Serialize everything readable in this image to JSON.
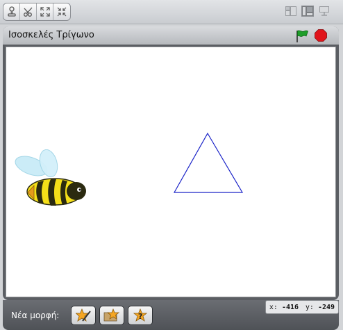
{
  "toolbar": {
    "tools": [
      {
        "icon": "stamp-icon"
      },
      {
        "icon": "scissors-icon"
      },
      {
        "icon": "grow-icon"
      },
      {
        "icon": "shrink-icon"
      }
    ],
    "view_modes": [
      {
        "icon": "small-stage-icon"
      },
      {
        "icon": "normal-stage-icon",
        "active": true
      },
      {
        "icon": "presentation-mode-icon"
      }
    ]
  },
  "stage": {
    "title": "Ισοσκελές Τρίγωνο",
    "green_flag_icon": "green-flag-icon",
    "stop_icon": "stop-sign-icon",
    "background": "#ffffff",
    "triangle_color": "#1a23c8",
    "sprite_name_icon": "bee-icon"
  },
  "bottom": {
    "new_sprite_label": "Νέα μορφή:",
    "buttons": [
      {
        "icon": "paint-new-sprite-icon"
      },
      {
        "icon": "choose-sprite-from-file-icon"
      },
      {
        "icon": "surprise-sprite-icon"
      }
    ],
    "mouse_x_label": "x:",
    "mouse_x_value": "-416",
    "mouse_y_label": "y:",
    "mouse_y_value": "-249"
  },
  "colors": {
    "panel_dark": "#5b5e63",
    "flag_green": "#1e9e2a",
    "stop_red": "#e0141b"
  }
}
